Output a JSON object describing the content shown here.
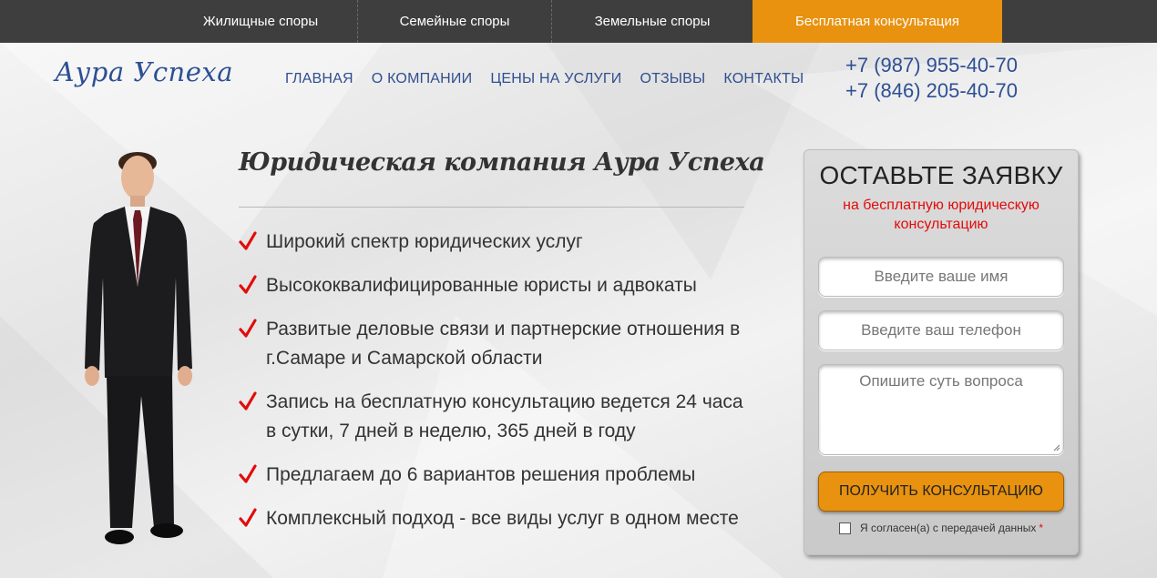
{
  "topbar": {
    "tabs": [
      {
        "label": "Жилищные споры"
      },
      {
        "label": "Семейные споры"
      },
      {
        "label": "Земельные споры"
      },
      {
        "label": "Бесплатная консультация"
      }
    ]
  },
  "header": {
    "logo": "Аура Успеха",
    "nav": [
      {
        "label": "ГЛАВНАЯ"
      },
      {
        "label": "О КОМПАНИИ"
      },
      {
        "label": "ЦЕНЫ НА УСЛУГИ"
      },
      {
        "label": "ОТЗЫВЫ"
      },
      {
        "label": "КОНТАКТЫ"
      }
    ],
    "phones": [
      "+7 (987) 955-40-70",
      "+7 (846) 205-40-70"
    ]
  },
  "main": {
    "title": "Юридическая компания Аура Успеха",
    "features": [
      "Широкий спектр юридических услуг",
      "Высококвалифицированные юристы и адвокаты",
      "Развитые деловые связи и партнерские отношения в г.Самаре и Самарской области",
      "Запись на бесплатную консультацию ведется 24 часа в сутки, 7 дней в неделю, 365 дней в году",
      "Предлагаем до 6 вариантов решения проблемы",
      "Комплексный подход - все виды услуг в одном месте"
    ]
  },
  "form": {
    "title": "ОСТАВЬТЕ ЗАЯВКУ",
    "subtitle": "на бесплатную юридическую консультацию",
    "name_placeholder": "Введите ваше имя",
    "phone_placeholder": "Введите ваш телефон",
    "question_placeholder": "Опишите суть вопроса",
    "submit_label": "ПОЛУЧИТЬ КОНСУЛЬТАЦИЮ",
    "agree_label": "Я согласен(а) с передачей данных",
    "required_mark": "*"
  },
  "colors": {
    "accent": "#e8920f",
    "brand": "#2d4f94",
    "topbar": "#3f3e3f",
    "check": "#e30b0b"
  }
}
